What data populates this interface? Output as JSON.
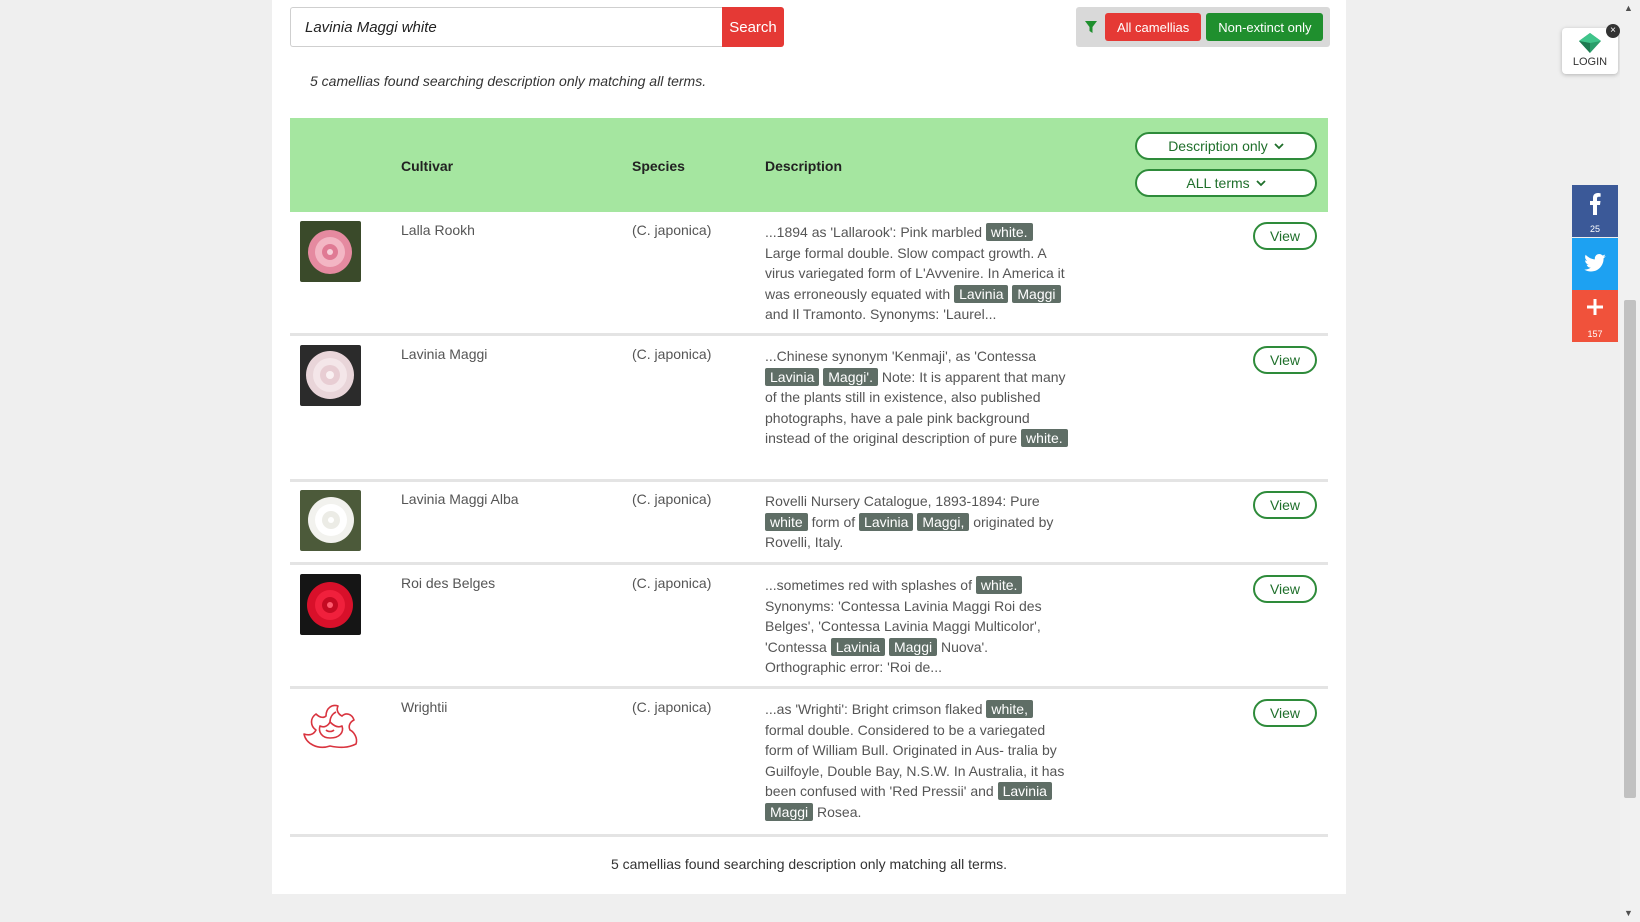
{
  "search": {
    "value": "Lavinia Maggi white",
    "button_label": "Search"
  },
  "filters": {
    "icon": "filter-icon",
    "all_label": "All camellias",
    "nonextinct_label": "Non-extinct only"
  },
  "summary_top": "5 camellias found searching description only matching all terms.",
  "table": {
    "headers": {
      "cultivar": "Cultivar",
      "species": "Species",
      "description": "Description"
    },
    "dropdowns": {
      "scope": "Description only",
      "terms": "ALL terms"
    },
    "view_label": "View",
    "rows": [
      {
        "cultivar": "Lalla Rookh",
        "species": "(C. japonica)",
        "desc": [
          {
            "t": "...1894 as 'Lallarook': Pink marbled "
          },
          {
            "t": "white.",
            "h": true
          },
          {
            "t": " Large formal double. Slow compact growth. A virus variegated form of L'Avvenire. In America it was erroneously equated with "
          },
          {
            "t": "Lavinia",
            "h": true
          },
          {
            "t": " "
          },
          {
            "t": "Maggi",
            "h": true
          },
          {
            "t": " and Il Tramonto. Synonyms: 'Laurel..."
          }
        ]
      },
      {
        "cultivar": "Lavinia Maggi",
        "species": "(C. japonica)",
        "desc": [
          {
            "t": "...Chinese synonym 'Kenmaji', as 'Contessa "
          },
          {
            "t": "Lavinia",
            "h": true
          },
          {
            "t": " "
          },
          {
            "t": "Maggi'.",
            "h": true
          },
          {
            "t": " Note: It is apparent that many of the plants still in existence, also published photographs, have a pale pink background instead of the original description of pure "
          },
          {
            "t": "white.",
            "h": true
          }
        ]
      },
      {
        "cultivar": "Lavinia Maggi Alba",
        "species": "(C. japonica)",
        "desc": [
          {
            "t": "Rovelli Nursery Catalogue, 1893-1894: Pure "
          },
          {
            "t": "white",
            "h": true
          },
          {
            "t": " form of "
          },
          {
            "t": "Lavinia",
            "h": true
          },
          {
            "t": " "
          },
          {
            "t": "Maggi,",
            "h": true
          },
          {
            "t": " originated by Rovelli, Italy."
          }
        ]
      },
      {
        "cultivar": "Roi des Belges",
        "species": "(C. japonica)",
        "desc": [
          {
            "t": "...sometimes red with splashes of "
          },
          {
            "t": "white.",
            "h": true
          },
          {
            "t": " Synonyms: 'Contessa Lavinia Maggi Roi des Belges', 'Contessa Lavinia Maggi Multicolor', 'Contessa "
          },
          {
            "t": "Lavinia",
            "h": true
          },
          {
            "t": " "
          },
          {
            "t": "Maggi",
            "h": true
          },
          {
            "t": " Nuova'. Orthographic error: 'Roi de..."
          }
        ]
      },
      {
        "cultivar": "Wrightii",
        "species": "(C. japonica)",
        "desc": [
          {
            "t": "...as 'Wrighti': Bright crimson flaked "
          },
          {
            "t": "white,",
            "h": true
          },
          {
            "t": " formal double. Considered to be a variegated form of William Bull. Originated in Aus- tralia by Guilfoyle, Double Bay, N.S.W. In Australia, it has been confused with 'Red Pressii' and "
          },
          {
            "t": "Lavinia",
            "h": true
          },
          {
            "t": " "
          },
          {
            "t": "Maggi",
            "h": true
          },
          {
            "t": " Rosea."
          }
        ]
      }
    ]
  },
  "summary_bottom": "5 camellias found searching description only matching all terms.",
  "side": {
    "login_label": "LOGIN",
    "facebook_count": "25",
    "plus_count": "157"
  },
  "colors": {
    "header_bg": "#a5e6a0",
    "search_red": "#e53935",
    "green": "#1f8f2e",
    "highlight": "#5f6e66"
  }
}
